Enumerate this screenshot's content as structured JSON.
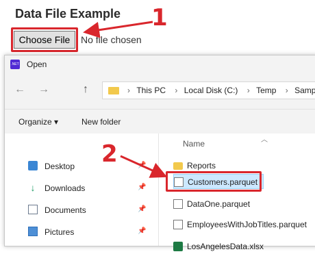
{
  "page": {
    "title": "Data File Example",
    "file_input": {
      "button_label": "Choose File",
      "status_text": "No file chosen"
    },
    "callouts": {
      "step1": "1",
      "step2": "2",
      "color": "#d9262c"
    }
  },
  "dialog": {
    "title": "Open",
    "app_icon_text": ".NET",
    "address": {
      "crumbs": [
        "This PC",
        "Local Disk (C:)",
        "Temp",
        "Sample P"
      ]
    },
    "commands": {
      "organize": "Organize ▾",
      "new_folder": "New folder"
    },
    "nav": {
      "items": [
        {
          "label": "Desktop",
          "icon": "desktop-icon"
        },
        {
          "label": "Downloads",
          "icon": "downloads-icon"
        },
        {
          "label": "Documents",
          "icon": "documents-icon"
        },
        {
          "label": "Pictures",
          "icon": "pictures-icon"
        }
      ]
    },
    "files": {
      "column_header": "Name",
      "items": [
        {
          "name": "Reports",
          "type": "folder"
        },
        {
          "name": "Customers.parquet",
          "type": "file",
          "selected": true
        },
        {
          "name": "DataOne.parquet",
          "type": "file"
        },
        {
          "name": "EmployeesWithJobTitles.parquet",
          "type": "file"
        },
        {
          "name": "LosAngelesData.xlsx",
          "type": "xlsx"
        }
      ]
    }
  }
}
